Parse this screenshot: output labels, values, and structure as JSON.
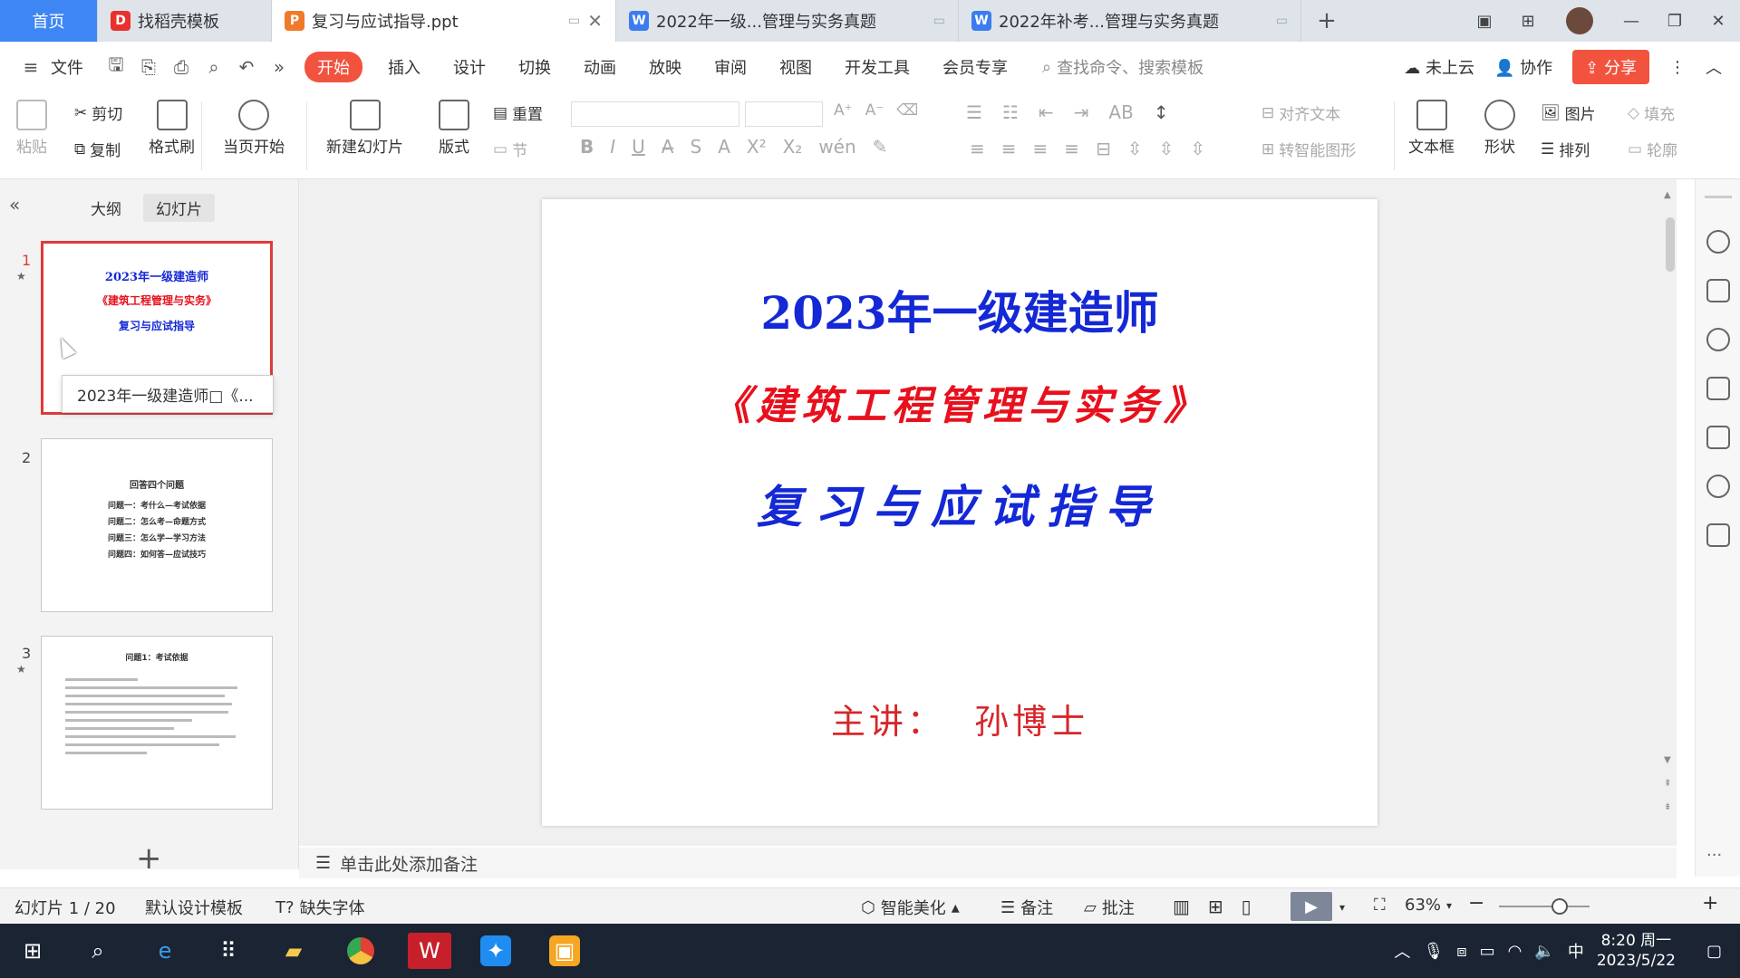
{
  "tabs": {
    "home": "首页",
    "template": "找稻壳模板",
    "active_doc": "复习与应试指导.ppt",
    "doc1": "2022年一级...管理与实务真题",
    "doc2": "2022年补考...管理与实务真题"
  },
  "menu": {
    "file": "文件",
    "items": [
      "开始",
      "插入",
      "设计",
      "切换",
      "动画",
      "放映",
      "审阅",
      "视图",
      "开发工具",
      "会员专享"
    ],
    "search": "查找命令、搜索模板",
    "cloud": "未上云",
    "collab": "协作",
    "share": "分享"
  },
  "ribbon": {
    "paste": "粘贴",
    "cut": "剪切",
    "copy": "复制",
    "format_painter": "格式刷",
    "from_current": "当页开始",
    "new_slide": "新建幻灯片",
    "layout": "版式",
    "section": "节",
    "reset": "重置",
    "align_text": "对齐文本",
    "smart_art": "转智能图形",
    "textbox": "文本框",
    "shape": "形状",
    "picture": "图片",
    "arrange": "排列",
    "fill": "填充",
    "outline": "轮廓"
  },
  "panel": {
    "outline_tab": "大纲",
    "slides_tab": "幻灯片",
    "tooltip": "2023年一级建造师□《...",
    "thumbs": [
      {
        "num": "1",
        "lines": [
          "2023年一级建造师",
          "《建筑工程管理与实务》",
          "复习与应试指导"
        ]
      },
      {
        "num": "2",
        "lines": [
          "回答四个问题",
          "问题一：考什么—考试依据",
          "问题二：怎么考—命题方式",
          "问题三：怎么学—学习方法",
          "问题四：如何答—应试技巧"
        ]
      },
      {
        "num": "3",
        "lines": [
          "问题1：考试依据"
        ]
      }
    ]
  },
  "slide": {
    "title": "2023年一级建造师",
    "subtitle": "《建筑工程管理与实务》",
    "heading": "复习与应试指导",
    "presenter": "主讲：  孙博士"
  },
  "notes_placeholder": "单击此处添加备注",
  "status": {
    "slide_count": "幻灯片 1 / 20",
    "template": "默认设计模板",
    "missing_font": "缺失字体",
    "beautify": "智能美化",
    "notes": "备注",
    "comment": "批注",
    "zoom": "63%"
  },
  "taskbar": {
    "ime": "中",
    "time": "8:20 周一",
    "date": "2023/5/22"
  },
  "colors": {
    "accent": "#f2533f",
    "title_blue": "#1428d6",
    "subtitle_red": "#e8101c",
    "presenter_red": "#d7262a"
  }
}
